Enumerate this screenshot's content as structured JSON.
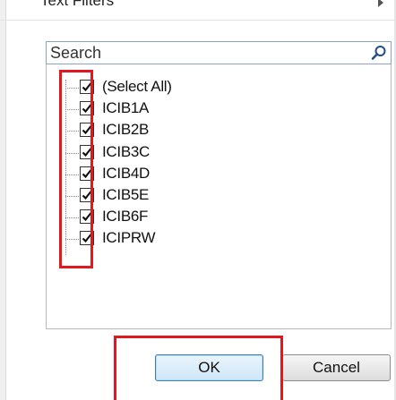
{
  "menu": {
    "text_filters_label": "Text Filters"
  },
  "search": {
    "placeholder": "Search",
    "value": ""
  },
  "list": {
    "items": [
      {
        "label": "(Select All)",
        "checked": true
      },
      {
        "label": "ICIB1A",
        "checked": true
      },
      {
        "label": "ICIB2B",
        "checked": true
      },
      {
        "label": "ICIB3C",
        "checked": true
      },
      {
        "label": "ICIB4D",
        "checked": true
      },
      {
        "label": "ICIB5E",
        "checked": true
      },
      {
        "label": "ICIB6F",
        "checked": true
      },
      {
        "label": "ICIPRW",
        "checked": true
      }
    ]
  },
  "buttons": {
    "ok_label": "OK",
    "cancel_label": "Cancel"
  },
  "colors": {
    "highlight": "#e0191f",
    "ok_border": "#3c7fb1"
  }
}
